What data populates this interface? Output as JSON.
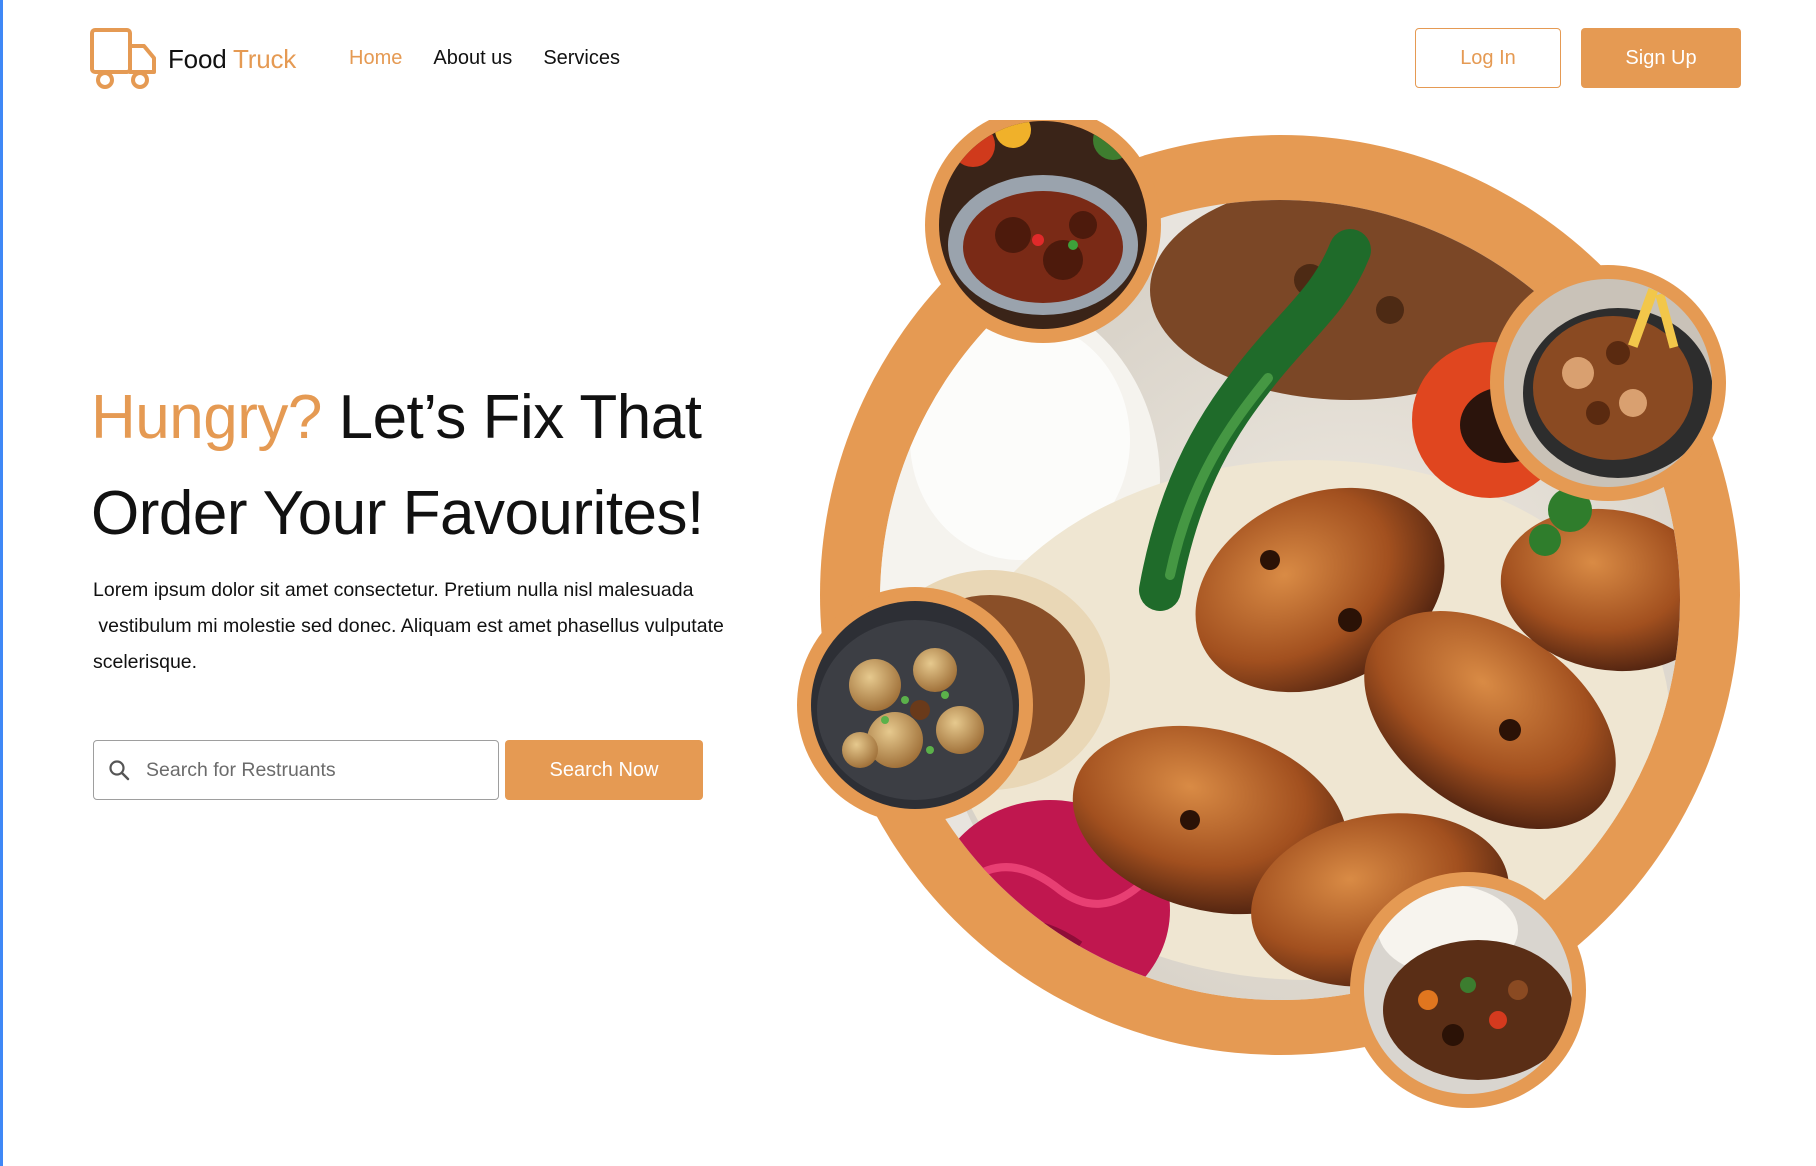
{
  "brand": {
    "name_primary": "Food",
    "name_accent": "Truck",
    "logo_icon": "truck-icon",
    "accent_color": "#e59a53"
  },
  "nav": {
    "items": [
      {
        "label": "Home",
        "active": true
      },
      {
        "label": "About us",
        "active": false
      },
      {
        "label": "Services",
        "active": false
      }
    ]
  },
  "auth": {
    "login_label": "Log In",
    "signup_label": "Sign Up"
  },
  "hero": {
    "headline_accent": "Hungry?",
    "headline_rest": " Let’s Fix That",
    "headline_line2": "Order Your Favourites!",
    "description_line1": "Lorem ipsum dolor sit amet consectetur. Pretium nulla nisl malesuada",
    "description_line2": " vestibulum mi molestie sed donec. Aliquam est amet phasellus vulputate",
    "description_line3": "scelerisque."
  },
  "search": {
    "placeholder": "Search for Restruants",
    "icon": "search-icon",
    "button_label": "Search Now"
  },
  "colors": {
    "accent": "#e59a53",
    "text": "#111111",
    "input_border": "#9e9e9e"
  }
}
